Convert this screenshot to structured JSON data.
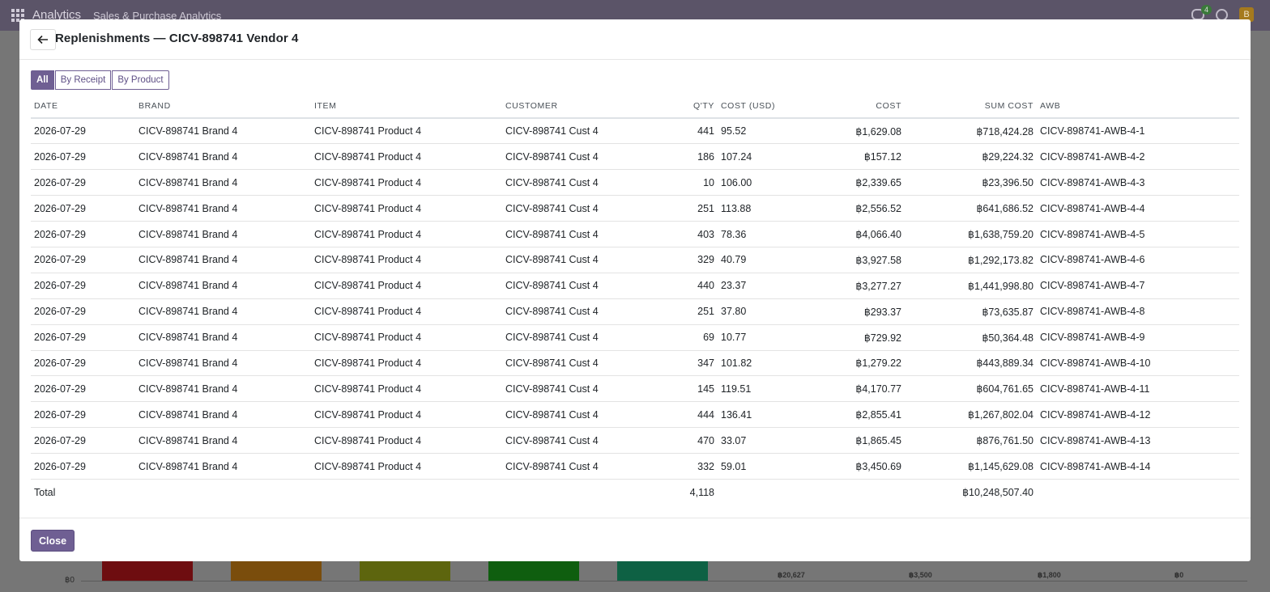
{
  "app": {
    "name": "Analytics",
    "breadcrumb": "Sales & Purchase Analytics",
    "chat_count": "4",
    "avatar_initial": "B"
  },
  "background_chart": {
    "y_label": "฿0",
    "values": [
      "฿20,627",
      "฿3,500",
      "฿1,800",
      "฿0"
    ],
    "bar_colors": [
      "#6e0d10",
      "#7a4d0c",
      "#5d650e",
      "#0f5e0f",
      "#0e6144"
    ]
  },
  "modal": {
    "title": "Replenishments — CICV-898741 Vendor 4",
    "tabs": [
      {
        "label": "All",
        "active": true
      },
      {
        "label": "By Receipt",
        "active": false
      },
      {
        "label": "By Product",
        "active": false
      }
    ],
    "columns": [
      "DATE",
      "BRAND",
      "ITEM",
      "CUSTOMER",
      "Q'TY",
      "COST (USD)",
      "COST",
      "SUM COST",
      "AWB"
    ],
    "rows": [
      [
        "2026-07-29",
        "CICV-898741 Brand 4",
        "CICV-898741 Product 4",
        "CICV-898741 Cust 4",
        "441",
        "95.52",
        "฿1,629.08",
        "฿718,424.28",
        "CICV-898741-AWB-4-1"
      ],
      [
        "2026-07-29",
        "CICV-898741 Brand 4",
        "CICV-898741 Product 4",
        "CICV-898741 Cust 4",
        "186",
        "107.24",
        "฿157.12",
        "฿29,224.32",
        "CICV-898741-AWB-4-2"
      ],
      [
        "2026-07-29",
        "CICV-898741 Brand 4",
        "CICV-898741 Product 4",
        "CICV-898741 Cust 4",
        "10",
        "106.00",
        "฿2,339.65",
        "฿23,396.50",
        "CICV-898741-AWB-4-3"
      ],
      [
        "2026-07-29",
        "CICV-898741 Brand 4",
        "CICV-898741 Product 4",
        "CICV-898741 Cust 4",
        "251",
        "113.88",
        "฿2,556.52",
        "฿641,686.52",
        "CICV-898741-AWB-4-4"
      ],
      [
        "2026-07-29",
        "CICV-898741 Brand 4",
        "CICV-898741 Product 4",
        "CICV-898741 Cust 4",
        "403",
        "78.36",
        "฿4,066.40",
        "฿1,638,759.20",
        "CICV-898741-AWB-4-5"
      ],
      [
        "2026-07-29",
        "CICV-898741 Brand 4",
        "CICV-898741 Product 4",
        "CICV-898741 Cust 4",
        "329",
        "40.79",
        "฿3,927.58",
        "฿1,292,173.82",
        "CICV-898741-AWB-4-6"
      ],
      [
        "2026-07-29",
        "CICV-898741 Brand 4",
        "CICV-898741 Product 4",
        "CICV-898741 Cust 4",
        "440",
        "23.37",
        "฿3,277.27",
        "฿1,441,998.80",
        "CICV-898741-AWB-4-7"
      ],
      [
        "2026-07-29",
        "CICV-898741 Brand 4",
        "CICV-898741 Product 4",
        "CICV-898741 Cust 4",
        "251",
        "37.80",
        "฿293.37",
        "฿73,635.87",
        "CICV-898741-AWB-4-8"
      ],
      [
        "2026-07-29",
        "CICV-898741 Brand 4",
        "CICV-898741 Product 4",
        "CICV-898741 Cust 4",
        "69",
        "10.77",
        "฿729.92",
        "฿50,364.48",
        "CICV-898741-AWB-4-9"
      ],
      [
        "2026-07-29",
        "CICV-898741 Brand 4",
        "CICV-898741 Product 4",
        "CICV-898741 Cust 4",
        "347",
        "101.82",
        "฿1,279.22",
        "฿443,889.34",
        "CICV-898741-AWB-4-10"
      ],
      [
        "2026-07-29",
        "CICV-898741 Brand 4",
        "CICV-898741 Product 4",
        "CICV-898741 Cust 4",
        "145",
        "119.51",
        "฿4,170.77",
        "฿604,761.65",
        "CICV-898741-AWB-4-11"
      ],
      [
        "2026-07-29",
        "CICV-898741 Brand 4",
        "CICV-898741 Product 4",
        "CICV-898741 Cust 4",
        "444",
        "136.41",
        "฿2,855.41",
        "฿1,267,802.04",
        "CICV-898741-AWB-4-12"
      ],
      [
        "2026-07-29",
        "CICV-898741 Brand 4",
        "CICV-898741 Product 4",
        "CICV-898741 Cust 4",
        "470",
        "33.07",
        "฿1,865.45",
        "฿876,761.50",
        "CICV-898741-AWB-4-13"
      ],
      [
        "2026-07-29",
        "CICV-898741 Brand 4",
        "CICV-898741 Product 4",
        "CICV-898741 Cust 4",
        "332",
        "59.01",
        "฿3,450.69",
        "฿1,145,629.08",
        "CICV-898741-AWB-4-14"
      ]
    ],
    "total": {
      "label": "Total",
      "qty": "4,118",
      "sum_cost": "฿10,248,507.40"
    },
    "close_label": "Close"
  }
}
